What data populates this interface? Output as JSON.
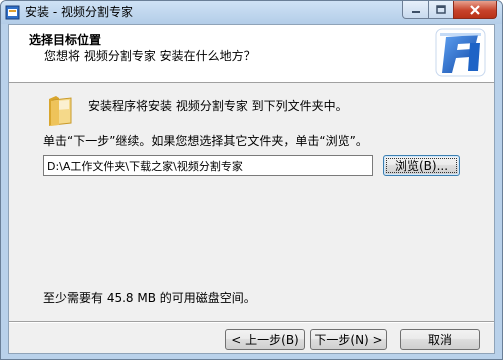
{
  "window": {
    "title": "安装 - 视频分割专家"
  },
  "header": {
    "title": "选择目标位置",
    "subtitle": "您想将 视频分割专家 安装在什么地方？"
  },
  "body": {
    "destination_text": "安装程序将安装 视频分割专家 到下列文件夹中。",
    "instruction_text": "单击“下一步”继续。如果您想选择其它文件夹，单击“浏览”。",
    "install_path": "D:\\A工作文件夹\\下载之家\\视频分割专家",
    "browse_label": "浏览(B)...",
    "disk_space_text": "至少需要有 45.8 MB 的可用磁盘空间。"
  },
  "footer": {
    "back_label": "< 上一步(B)",
    "next_label": "下一步(N) >",
    "cancel_label": "取消"
  },
  "icons": {
    "app": "installer-icon",
    "folder": "folder-icon",
    "logo": "app-logo"
  },
  "colors": {
    "titlebar": "#b9d1ea",
    "close_button": "#c7432b",
    "logo_blue": "#1e63c6"
  }
}
